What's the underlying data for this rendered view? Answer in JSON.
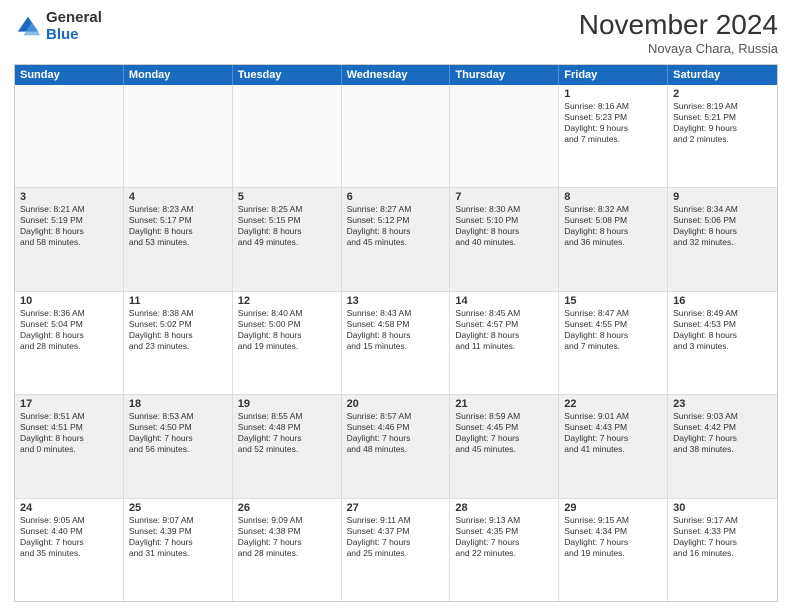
{
  "logo": {
    "general": "General",
    "blue": "Blue"
  },
  "header": {
    "month": "November 2024",
    "location": "Novaya Chara, Russia"
  },
  "weekdays": [
    "Sunday",
    "Monday",
    "Tuesday",
    "Wednesday",
    "Thursday",
    "Friday",
    "Saturday"
  ],
  "rows": [
    [
      {
        "day": "",
        "text": "",
        "empty": true
      },
      {
        "day": "",
        "text": "",
        "empty": true
      },
      {
        "day": "",
        "text": "",
        "empty": true
      },
      {
        "day": "",
        "text": "",
        "empty": true
      },
      {
        "day": "",
        "text": "",
        "empty": true
      },
      {
        "day": "1",
        "text": "Sunrise: 8:16 AM\nSunset: 5:23 PM\nDaylight: 9 hours\nand 7 minutes.",
        "empty": false
      },
      {
        "day": "2",
        "text": "Sunrise: 8:19 AM\nSunset: 5:21 PM\nDaylight: 9 hours\nand 2 minutes.",
        "empty": false
      }
    ],
    [
      {
        "day": "3",
        "text": "Sunrise: 8:21 AM\nSunset: 5:19 PM\nDaylight: 8 hours\nand 58 minutes.",
        "empty": false
      },
      {
        "day": "4",
        "text": "Sunrise: 8:23 AM\nSunset: 5:17 PM\nDaylight: 8 hours\nand 53 minutes.",
        "empty": false
      },
      {
        "day": "5",
        "text": "Sunrise: 8:25 AM\nSunset: 5:15 PM\nDaylight: 8 hours\nand 49 minutes.",
        "empty": false
      },
      {
        "day": "6",
        "text": "Sunrise: 8:27 AM\nSunset: 5:12 PM\nDaylight: 8 hours\nand 45 minutes.",
        "empty": false
      },
      {
        "day": "7",
        "text": "Sunrise: 8:30 AM\nSunset: 5:10 PM\nDaylight: 8 hours\nand 40 minutes.",
        "empty": false
      },
      {
        "day": "8",
        "text": "Sunrise: 8:32 AM\nSunset: 5:08 PM\nDaylight: 8 hours\nand 36 minutes.",
        "empty": false
      },
      {
        "day": "9",
        "text": "Sunrise: 8:34 AM\nSunset: 5:06 PM\nDaylight: 8 hours\nand 32 minutes.",
        "empty": false
      }
    ],
    [
      {
        "day": "10",
        "text": "Sunrise: 8:36 AM\nSunset: 5:04 PM\nDaylight: 8 hours\nand 28 minutes.",
        "empty": false
      },
      {
        "day": "11",
        "text": "Sunrise: 8:38 AM\nSunset: 5:02 PM\nDaylight: 8 hours\nand 23 minutes.",
        "empty": false
      },
      {
        "day": "12",
        "text": "Sunrise: 8:40 AM\nSunset: 5:00 PM\nDaylight: 8 hours\nand 19 minutes.",
        "empty": false
      },
      {
        "day": "13",
        "text": "Sunrise: 8:43 AM\nSunset: 4:58 PM\nDaylight: 8 hours\nand 15 minutes.",
        "empty": false
      },
      {
        "day": "14",
        "text": "Sunrise: 8:45 AM\nSunset: 4:57 PM\nDaylight: 8 hours\nand 11 minutes.",
        "empty": false
      },
      {
        "day": "15",
        "text": "Sunrise: 8:47 AM\nSunset: 4:55 PM\nDaylight: 8 hours\nand 7 minutes.",
        "empty": false
      },
      {
        "day": "16",
        "text": "Sunrise: 8:49 AM\nSunset: 4:53 PM\nDaylight: 8 hours\nand 3 minutes.",
        "empty": false
      }
    ],
    [
      {
        "day": "17",
        "text": "Sunrise: 8:51 AM\nSunset: 4:51 PM\nDaylight: 8 hours\nand 0 minutes.",
        "empty": false
      },
      {
        "day": "18",
        "text": "Sunrise: 8:53 AM\nSunset: 4:50 PM\nDaylight: 7 hours\nand 56 minutes.",
        "empty": false
      },
      {
        "day": "19",
        "text": "Sunrise: 8:55 AM\nSunset: 4:48 PM\nDaylight: 7 hours\nand 52 minutes.",
        "empty": false
      },
      {
        "day": "20",
        "text": "Sunrise: 8:57 AM\nSunset: 4:46 PM\nDaylight: 7 hours\nand 48 minutes.",
        "empty": false
      },
      {
        "day": "21",
        "text": "Sunrise: 8:59 AM\nSunset: 4:45 PM\nDaylight: 7 hours\nand 45 minutes.",
        "empty": false
      },
      {
        "day": "22",
        "text": "Sunrise: 9:01 AM\nSunset: 4:43 PM\nDaylight: 7 hours\nand 41 minutes.",
        "empty": false
      },
      {
        "day": "23",
        "text": "Sunrise: 9:03 AM\nSunset: 4:42 PM\nDaylight: 7 hours\nand 38 minutes.",
        "empty": false
      }
    ],
    [
      {
        "day": "24",
        "text": "Sunrise: 9:05 AM\nSunset: 4:40 PM\nDaylight: 7 hours\nand 35 minutes.",
        "empty": false
      },
      {
        "day": "25",
        "text": "Sunrise: 9:07 AM\nSunset: 4:39 PM\nDaylight: 7 hours\nand 31 minutes.",
        "empty": false
      },
      {
        "day": "26",
        "text": "Sunrise: 9:09 AM\nSunset: 4:38 PM\nDaylight: 7 hours\nand 28 minutes.",
        "empty": false
      },
      {
        "day": "27",
        "text": "Sunrise: 9:11 AM\nSunset: 4:37 PM\nDaylight: 7 hours\nand 25 minutes.",
        "empty": false
      },
      {
        "day": "28",
        "text": "Sunrise: 9:13 AM\nSunset: 4:35 PM\nDaylight: 7 hours\nand 22 minutes.",
        "empty": false
      },
      {
        "day": "29",
        "text": "Sunrise: 9:15 AM\nSunset: 4:34 PM\nDaylight: 7 hours\nand 19 minutes.",
        "empty": false
      },
      {
        "day": "30",
        "text": "Sunrise: 9:17 AM\nSunset: 4:33 PM\nDaylight: 7 hours\nand 16 minutes.",
        "empty": false
      }
    ]
  ]
}
